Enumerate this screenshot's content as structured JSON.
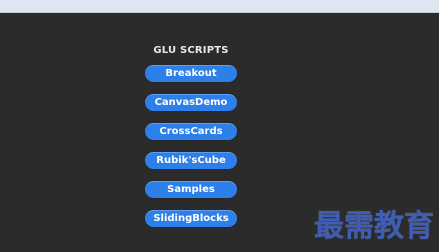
{
  "header": {
    "title": "GLU SCRIPTS"
  },
  "scripts": [
    "Breakout",
    "CanvasDemo",
    "CrossCards",
    "Rubik'sCube",
    "Samples",
    "SlidingBlocks"
  ],
  "watermark": {
    "text": "最需教育"
  },
  "colors": {
    "background": "#2b2b2b",
    "button": "#2d7fea",
    "title": "#e9e9e9",
    "watermark": "#3f5db4"
  }
}
